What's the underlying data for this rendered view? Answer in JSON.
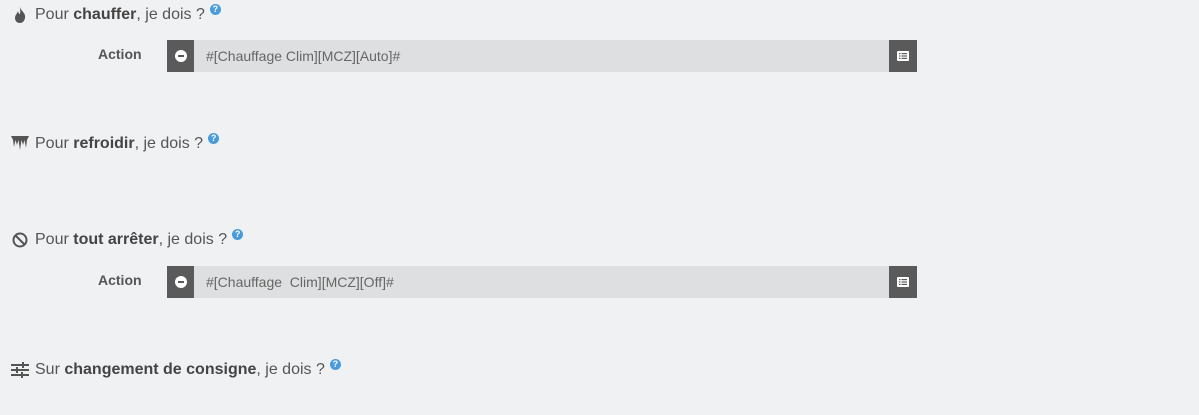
{
  "sections": [
    {
      "prefix": "Pour ",
      "bold": "chauffer",
      "suffix": ", je dois ?",
      "icon": "fire-icon",
      "help": "?"
    },
    {
      "prefix": "Pour ",
      "bold": "refroidir",
      "suffix": ", je dois ?",
      "icon": "icicles-icon",
      "help": "?"
    },
    {
      "prefix": "Pour ",
      "bold": "tout arrêter",
      "suffix": ", je dois ?",
      "icon": "ban-icon",
      "help": "?"
    },
    {
      "prefix": "Sur ",
      "bold": "changement de consigne",
      "suffix": ", je dois ?",
      "icon": "sliders-icon",
      "help": "?"
    }
  ],
  "actions": [
    {
      "label": "Action",
      "value": "#[Chauffage Clim][MCZ][Auto]#"
    },
    {
      "label": "Action",
      "value": "#[Chauffage  Clim][MCZ][Off]#"
    }
  ],
  "colors": {
    "background": "#f0f1f3",
    "help": "#4a9bdb",
    "button": "#5a5a5a",
    "field": "#dedfe0"
  }
}
